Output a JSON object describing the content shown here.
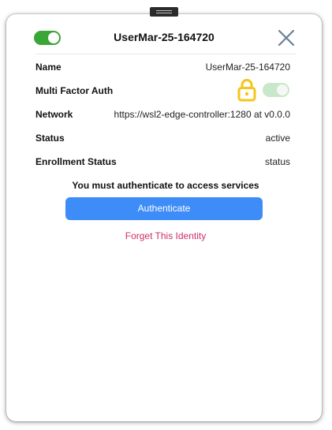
{
  "header": {
    "title": "UserMar-25-164720",
    "toggle_state": "on",
    "toggle_color": "#3aa635",
    "close_icon": "close-icon"
  },
  "details": {
    "name_label": "Name",
    "name_value": "UserMar-25-164720",
    "mfa_label": "Multi Factor Auth",
    "mfa_icon": "lock-icon",
    "mfa_icon_color": "#f5c518",
    "mfa_toggle_state": "on-disabled",
    "network_label": "Network",
    "network_value": "https://wsl2-edge-controller:1280 at v0.0.0",
    "status_label": "Status",
    "status_value": "active",
    "enrollment_label": "Enrollment Status",
    "enrollment_value": "status"
  },
  "auth": {
    "message": "You must authenticate to access services",
    "button_label": "Authenticate",
    "button_color": "#3d8cf7",
    "forget_label": "Forget This Identity",
    "forget_color": "#cc2f6a"
  }
}
